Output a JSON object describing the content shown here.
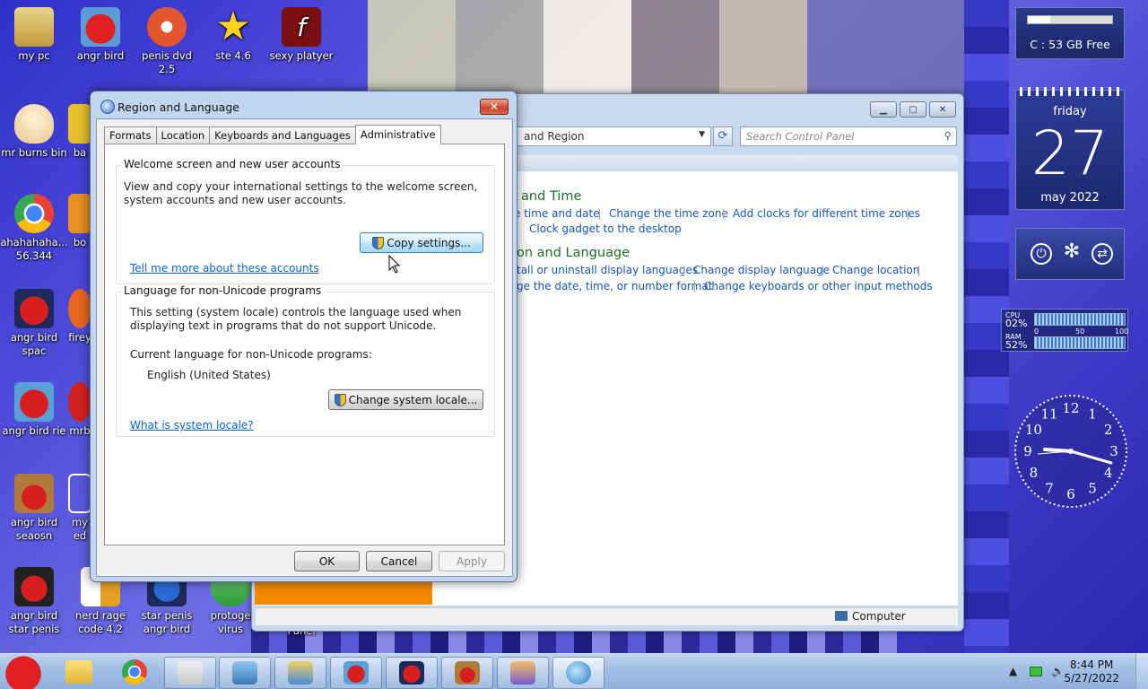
{
  "desktop": {
    "icons": [
      {
        "label": "my pc"
      },
      {
        "label": "angr bird"
      },
      {
        "label": "penis dvd 2.5"
      },
      {
        "label": "ste 4.6"
      },
      {
        "label": "sexy platyer"
      },
      {
        "label": "mr burns bin"
      },
      {
        "label": "ba"
      },
      {
        "label": "ahahahaha... 56.344"
      },
      {
        "label": "bo"
      },
      {
        "label": "angr bird spac"
      },
      {
        "label": "firey"
      },
      {
        "label": "angr bird rie"
      },
      {
        "label": "mrb"
      },
      {
        "label": "angr bird seaosn"
      },
      {
        "label": "my ed"
      },
      {
        "label": "angr bird star penis"
      },
      {
        "label": "nerd rage code 4.2"
      },
      {
        "label": "star penis angr bird"
      },
      {
        "label": "protoge virus"
      },
      {
        "label": "Panel"
      }
    ]
  },
  "control_panel": {
    "address": "and Region",
    "search_placeholder": "Search Control Panel",
    "status_text": "Computer",
    "sections": [
      {
        "heading": "and Time",
        "links": [
          "e time and date",
          "Change the time zone",
          "Add clocks for different time zones"
        ],
        "sublinks": [
          "Clock gadget to the desktop"
        ]
      },
      {
        "heading": "on and Language",
        "links": [
          "tall or uninstall display languages",
          "Change display language",
          "Change location"
        ],
        "sublinks": [
          "ge the date, time, or number format",
          "Change keyboards or other input methods"
        ]
      }
    ]
  },
  "dialog": {
    "title": "Region and Language",
    "close_label": "✕",
    "tabs": [
      "Formats",
      "Location",
      "Keyboards and Languages",
      "Administrative"
    ],
    "active_tab": "Administrative",
    "welcome_group": {
      "title": "Welcome screen and new user accounts",
      "description": "View and copy your international settings to the welcome screen, system accounts and new user accounts.",
      "copy_button": "Copy settings...",
      "link": "Tell me more about these accounts"
    },
    "unicode_group": {
      "title": "Language for non-Unicode programs",
      "description": "This setting (system locale) controls the language used when displaying text in programs that do not support Unicode.",
      "current_label": "Current language for non-Unicode programs:",
      "current_value": "English (United States)",
      "change_button": "Change system locale...",
      "link": "What is system locale?"
    },
    "buttons": {
      "ok": "OK",
      "cancel": "Cancel",
      "apply": "Apply"
    }
  },
  "gadgets": {
    "drive": {
      "label": "C : 53 GB Free",
      "used_fraction": 0.27
    },
    "calendar": {
      "day_name": "friday",
      "day": "27",
      "month_year": "may 2022"
    },
    "meters": {
      "cpu_label": "CPU",
      "cpu_value": "02%",
      "ram_label": "RAM",
      "ram_value": "52%",
      "scale": [
        "0",
        "50",
        "100"
      ]
    },
    "clock_numbers": [
      "12",
      "1",
      "2",
      "3",
      "4",
      "5",
      "6",
      "7",
      "8",
      "9",
      "10",
      "11"
    ]
  },
  "taskbar": {
    "time": "8:44 PM",
    "date": "5/27/2022"
  }
}
